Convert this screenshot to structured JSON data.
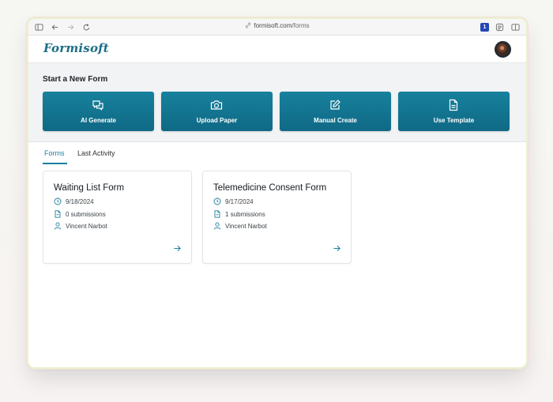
{
  "browser": {
    "url_host": "formisoft.com",
    "url_path": "/forms",
    "extension_badge": "1"
  },
  "app": {
    "logo": "Formisoft"
  },
  "start": {
    "title": "Start a New Form",
    "actions": [
      {
        "label": "AI Generate",
        "icon": "chat-bubbles-icon"
      },
      {
        "label": "Upload Paper",
        "icon": "camera-icon"
      },
      {
        "label": "Manual Create",
        "icon": "pencil-square-icon"
      },
      {
        "label": "Use Template",
        "icon": "document-icon"
      }
    ]
  },
  "tabs": [
    {
      "label": "Forms",
      "active": true
    },
    {
      "label": "Last Activity",
      "active": false
    }
  ],
  "forms": [
    {
      "title": "Waiting List Form",
      "date": "9/18/2024",
      "submissions": "0 submissions",
      "owner": "Vincent Narbot"
    },
    {
      "title": "Telemedicine Consent Form",
      "date": "9/17/2024",
      "submissions": "1 submissions",
      "owner": "Vincent Narbot"
    }
  ],
  "colors": {
    "accent": "#1b7f9e",
    "button": "#11708c"
  }
}
